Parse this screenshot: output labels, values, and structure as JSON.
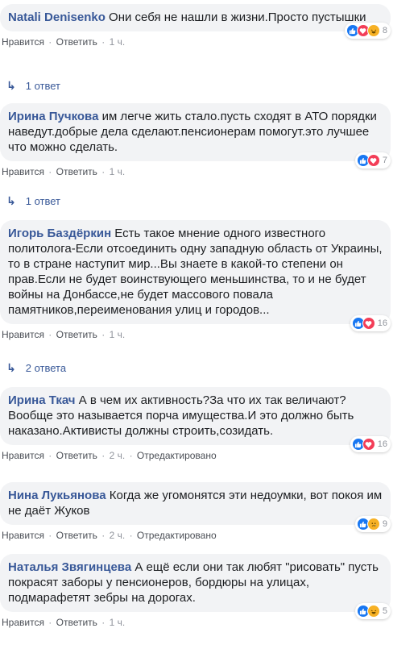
{
  "comments": [
    {
      "author": "Natali Denisenko",
      "text": "Они себя не нашли в жизни.Просто пустышки",
      "like_label": "Нравится",
      "reply_label": "Ответить",
      "time": "1 ч.",
      "edited": "",
      "reactions": [
        "like",
        "love",
        "haha"
      ],
      "reaction_count": "8",
      "replies": "1 ответ"
    },
    {
      "author": "Ирина Пучкова",
      "text": "им легче жить стало.пусть сходят в АТО порядки наведут.добрые дела сделают.пенсионерам помогут.это лучшее что можно сделать.",
      "like_label": "Нравится",
      "reply_label": "Ответить",
      "time": "1 ч.",
      "edited": "",
      "reactions": [
        "like",
        "love"
      ],
      "reaction_count": "7",
      "replies": "1 ответ"
    },
    {
      "author": "Игорь Баздёркин",
      "text": "Есть такое мнение одного известного политолога-Если отсоединить одну западную область от Украины, то в стране наступит мир...Вы знаете в какой-то степени он прав.Если не будет воинствующего меньшинства, то и не будет войны на Донбассе,не будет массового повала памятников,переименования улиц и городов...",
      "like_label": "Нравится",
      "reply_label": "Ответить",
      "time": "1 ч.",
      "edited": "",
      "reactions": [
        "like",
        "love"
      ],
      "reaction_count": "16",
      "replies": "2 ответа"
    },
    {
      "author": "Ирина Ткач",
      "text": "А в чем их активность?За что их так величают?Вообще это называется порча имущества.И это должно быть наказано.Активисты должны строить,созидать.",
      "like_label": "Нравится",
      "reply_label": "Ответить",
      "time": "2 ч.",
      "edited": "Отредактировано",
      "reactions": [
        "like",
        "love"
      ],
      "reaction_count": "16",
      "replies": ""
    },
    {
      "author": "Нина Лукьянова",
      "text": "Когда же угомонятся эти недоумки, вот покоя им не даёт Жуков",
      "like_label": "Нравится",
      "reply_label": "Ответить",
      "time": "2 ч.",
      "edited": "Отредактировано",
      "reactions": [
        "like",
        "sad"
      ],
      "reaction_count": "9",
      "replies": ""
    },
    {
      "author": "Наталья Звягинцева",
      "text": "А ещё если они так любят \"рисовать\" пусть покрасят заборы у пенсионеров, бордюры на улицах, подмарафетят зебры на дорогах.",
      "like_label": "Нравится",
      "reply_label": "Ответить",
      "time": "1 ч.",
      "edited": "",
      "reactions": [
        "like",
        "haha"
      ],
      "reaction_count": "5",
      "replies": ""
    }
  ]
}
